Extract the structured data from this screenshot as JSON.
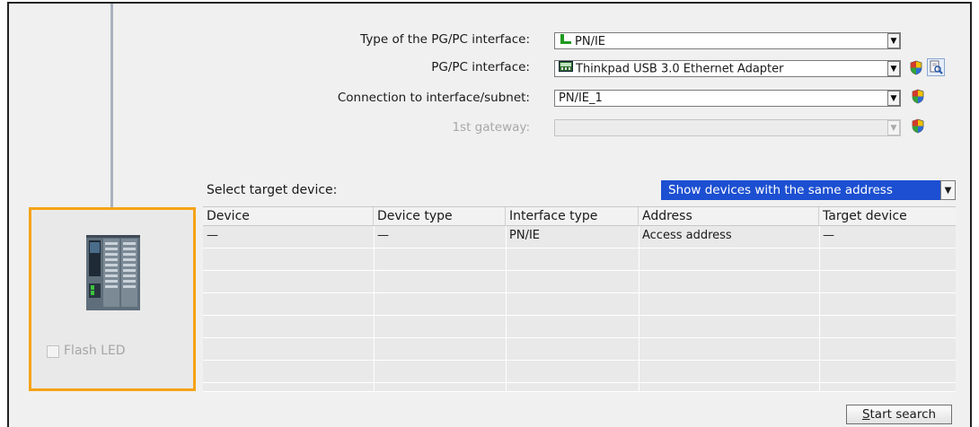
{
  "form": {
    "type_label": "Type of the PG/PC interface:",
    "type_value": "PN/IE",
    "pgpc_label": "PG/PC interface:",
    "pgpc_value": "Thinkpad USB 3.0 Ethernet Adapter",
    "conn_label": "Connection to interface/subnet:",
    "conn_value": "PN/IE_1",
    "gateway_label": "1st gateway:",
    "gateway_value": ""
  },
  "target": {
    "label": "Select target device:",
    "filter_value": "Show devices with the same address"
  },
  "table": {
    "headers": [
      "Device",
      "Device type",
      "Interface type",
      "Address",
      "Target device"
    ],
    "rows": [
      [
        "—",
        "—",
        "PN/IE",
        "Access address",
        "—"
      ]
    ]
  },
  "device_panel": {
    "flash_label": "Flash LED",
    "flash_checked": false
  },
  "buttons": {
    "start_search_prefix": "S",
    "start_search_rest": "tart search"
  },
  "colors": {
    "highlight_blue": "#1c4fd1",
    "panel_orange": "#f5a317"
  }
}
